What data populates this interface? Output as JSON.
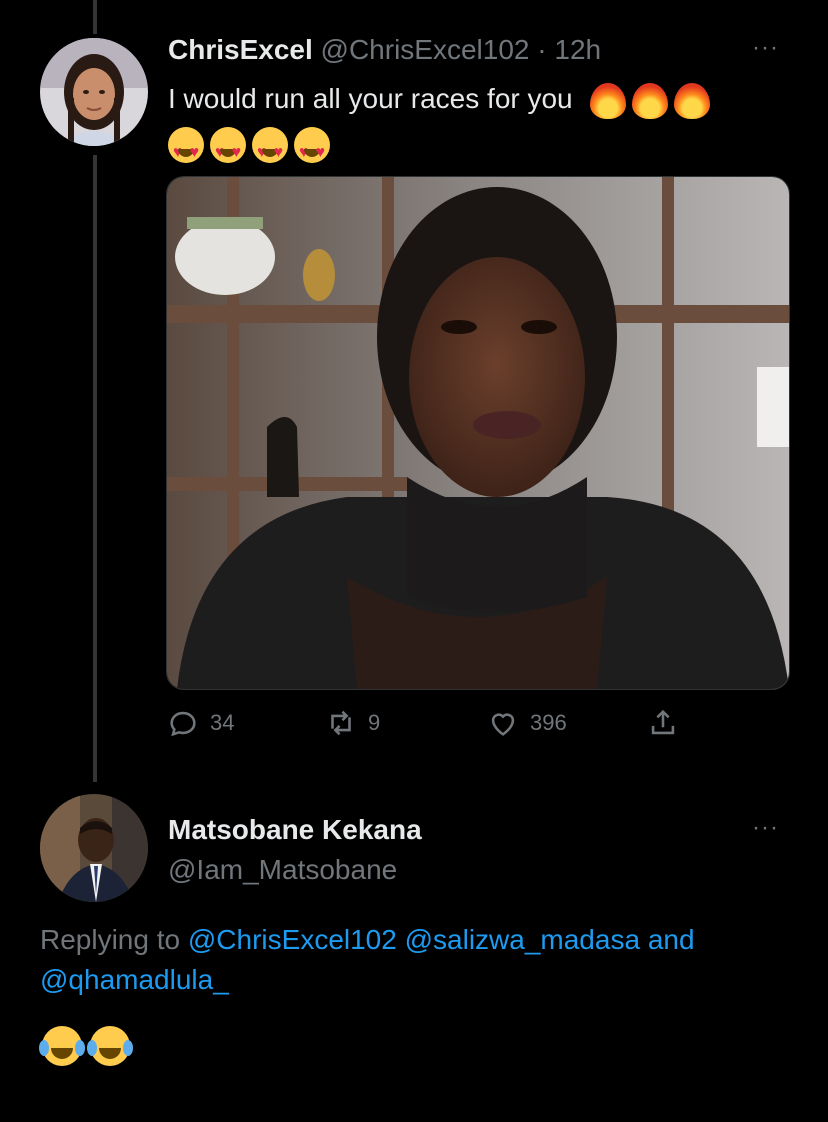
{
  "tweet1": {
    "display_name": "ChrisExcel",
    "handle": "@ChrisExcel102",
    "separator": "·",
    "time": "12h",
    "text": "I would run all your races for you",
    "emoji_line1": [
      "fire-emoji",
      "fire-emoji",
      "fire-emoji"
    ],
    "emoji_line2": [
      "heart-eyes-emoji",
      "heart-eyes-emoji",
      "heart-eyes-emoji",
      "heart-eyes-emoji"
    ],
    "more_label": "···",
    "media": {
      "type": "photo"
    },
    "stats": {
      "replies": "34",
      "retweets": "9",
      "likes": "396"
    }
  },
  "tweet2": {
    "display_name": "Matsobane Kekana",
    "handle": "@Iam_Matsobane",
    "more_label": "···",
    "replying_prefix": "Replying to",
    "mention1": "@ChrisExcel102",
    "mention2": "@salizwa_madasa",
    "connector": "and",
    "mention3": "@qhamadlula_",
    "emojis": [
      "joy-emoji",
      "joy-emoji"
    ]
  },
  "colors": {
    "background": "#000000",
    "text": "#e7e9ea",
    "muted": "#71767b",
    "link": "#1d9bf0",
    "thread_line": "#333639"
  }
}
